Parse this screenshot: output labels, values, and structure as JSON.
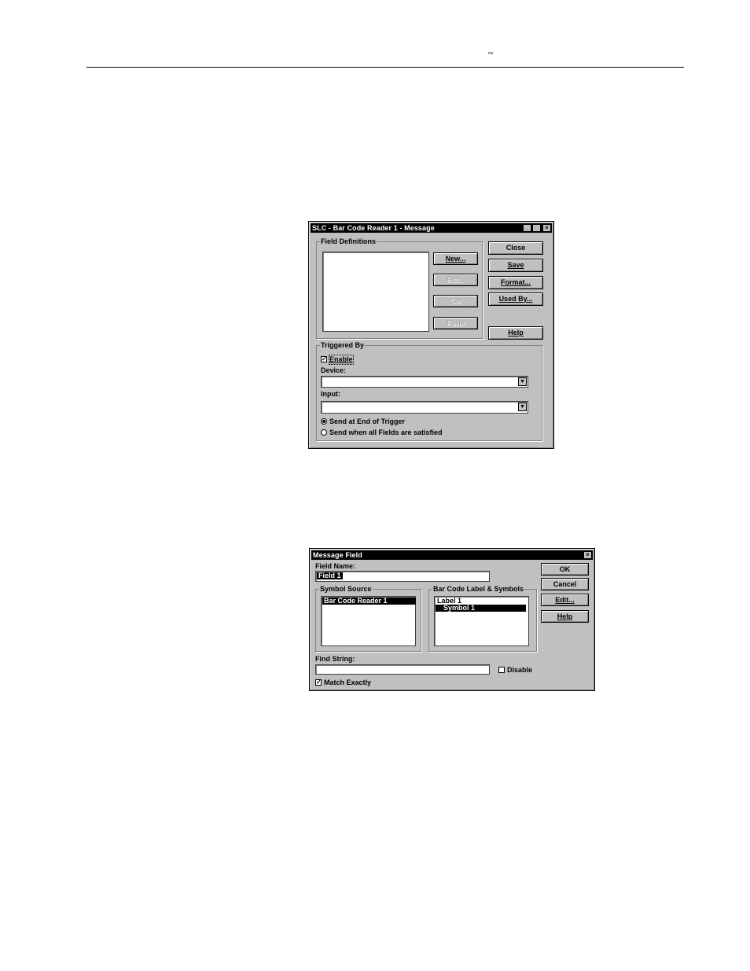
{
  "page": {
    "trademark": "™"
  },
  "dialog1": {
    "title": "SLC - Bar Code Reader 1 - Message",
    "title_buttons": [
      "_",
      "□",
      "×"
    ],
    "field_definitions_label": "Field Definitions",
    "buttons": {
      "new": "New...",
      "edit": "Edit...",
      "cut": "Cut",
      "paste": "Paste",
      "close": "Close",
      "save": "Save",
      "format": "Format...",
      "used_by": "Used By...",
      "help": "Help"
    },
    "triggered_by_label": "Triggered By",
    "enable_label": "Enable",
    "enable_checked": true,
    "device_label": "Device:",
    "device_value": "",
    "input_label": "Input:",
    "input_value": "",
    "radio_end_of_trigger": "Send at End of Trigger",
    "radio_all_fields": "Send when all Fields are satisfied",
    "selected_radio": "end_of_trigger"
  },
  "dialog2": {
    "title": "Message Field",
    "close_button": "×",
    "field_name_label": "Field Name:",
    "field_name_value": "Field 1",
    "symbol_source_label": "Symbol Source",
    "symbol_source_items": [
      "Bar Code Reader 1"
    ],
    "bar_code_label": "Bar Code Label & Symbols",
    "bar_code_items": [
      "Label 1",
      "Symbol 1"
    ],
    "buttons": {
      "ok": "OK",
      "cancel": "Cancel",
      "edit": "Edit...",
      "help": "Help"
    },
    "find_string_label": "Find String:",
    "find_string_value": "",
    "disable_label": "Disable",
    "disable_checked": false,
    "match_exactly_label": "Match Exactly",
    "match_exactly_checked": true
  }
}
